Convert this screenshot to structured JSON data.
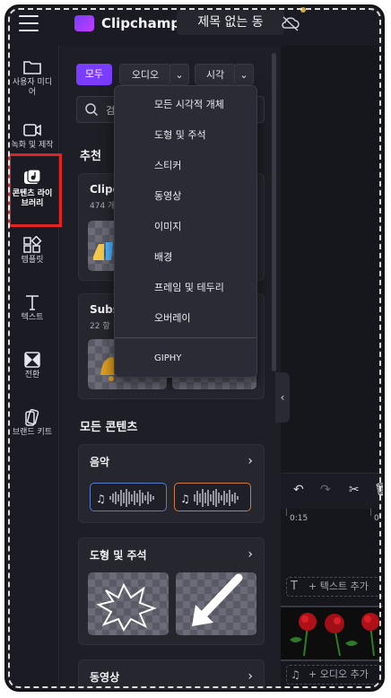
{
  "app": {
    "name": "Clipchamp",
    "document_title": "제목 없는 동"
  },
  "nav": {
    "items": [
      {
        "label": "사용자 미디\n어"
      },
      {
        "label": "녹화 및 제작"
      },
      {
        "label": "콘텐츠 라이\n브러리"
      },
      {
        "label": "템플릿"
      },
      {
        "label": "텍스트"
      },
      {
        "label": "전환"
      },
      {
        "label": "브랜드 키트"
      }
    ]
  },
  "filters": {
    "all": "모두",
    "audio": "오디오",
    "visual": "시각"
  },
  "search": {
    "visible_text": "검"
  },
  "recommended": {
    "title": "추천",
    "card1": {
      "title": "Clipc",
      "sub": "474 개"
    },
    "card2": {
      "title": "Subs",
      "sub": "22 항"
    }
  },
  "all_content": {
    "title": "모든 콘텐츠",
    "music": {
      "title": "음악"
    },
    "shapes": {
      "title": "도형 및 주석"
    },
    "videos": {
      "title": "동영상"
    }
  },
  "dropdown": {
    "items": [
      "모든 시각적 개체",
      "도형 및 주석",
      "스티커",
      "동영상",
      "이미지",
      "배경",
      "프레임 및 테두리",
      "오버레이"
    ],
    "footer_item": "GIPHY"
  },
  "timeline": {
    "ruler_labels": [
      "0:15",
      "0"
    ],
    "text_track": "+ 텍스트 추가",
    "audio_track": "+ 오디오 추가"
  }
}
